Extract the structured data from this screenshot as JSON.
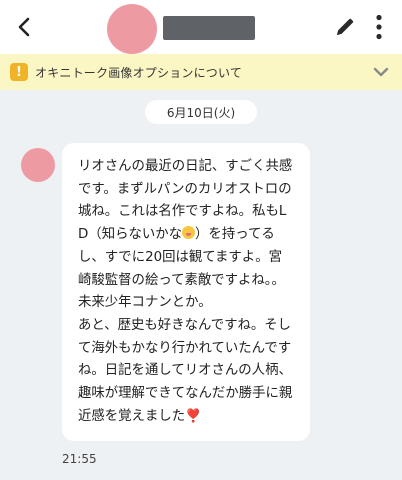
{
  "header": {
    "back_icon": "chevron-left-icon",
    "edit_icon": "pen-icon",
    "more_icon": "more-vertical-icon",
    "avatar_color": "#ee9aa3",
    "name_redaction_color": "#5f6368"
  },
  "banner": {
    "icon": "warning-icon",
    "icon_glyph": "!",
    "text": "オキニトーク画像オプションについて",
    "expand_icon": "chevron-down-icon",
    "background": "#fbf7c5"
  },
  "date_separator": "6月10日(火)",
  "message": {
    "line1": "リオさんの最近の日記、すごく共感",
    "line2": "です。まずルパンのカリオストロの",
    "line3": "城ね。これは名作ですよね。私もL",
    "line4_a": "D（知らないかな",
    "line4_emoji": "blushing-face-emoji",
    "line4_b": "）を持ってる",
    "line5": "し、すでに20回は観てますよ。宮",
    "line6": "崎駿監督の絵って素敵ですよね。。",
    "line7": "未来少年コナンとか。",
    "line8": "あと、歴史も好きなんですね。そし",
    "line9": "て海外もかなり行かれていたんです",
    "line10": "ね。日記を通してリオさんの人柄、",
    "line11": "趣味が理解できてなんだか勝手に親",
    "line12": "近感を覚えました",
    "line12_emoji": "❣️",
    "time": "21:55"
  }
}
